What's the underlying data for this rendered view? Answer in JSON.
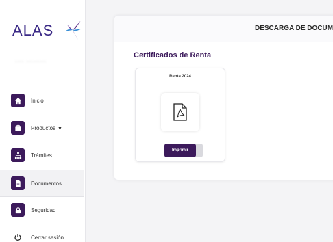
{
  "brand": {
    "name": "ALAS",
    "accent": "#3c1a5b",
    "logo_blue": "#3a8fd6",
    "logo_purple": "#5a2a86"
  },
  "user": {
    "name_blurred": "···· ·········"
  },
  "nav": [
    {
      "label": "Inicio",
      "icon": "home-icon"
    },
    {
      "label": "Productos",
      "icon": "briefcase-icon",
      "has_dropdown": true
    },
    {
      "label": "Trámites",
      "icon": "sitemap-icon"
    },
    {
      "label": "Documentos",
      "icon": "document-icon",
      "active": true
    },
    {
      "label": "Seguridad",
      "icon": "lock-icon"
    },
    {
      "label": "Cerrar sesión",
      "icon": "power-icon"
    }
  ],
  "main": {
    "header_title": "DESCARGA DE DOCUME",
    "section_title": "Certificados de Renta",
    "certificates": [
      {
        "year_label": "Renta 2024",
        "icon": "pdf-icon",
        "button_label": "Imprimir"
      }
    ]
  }
}
